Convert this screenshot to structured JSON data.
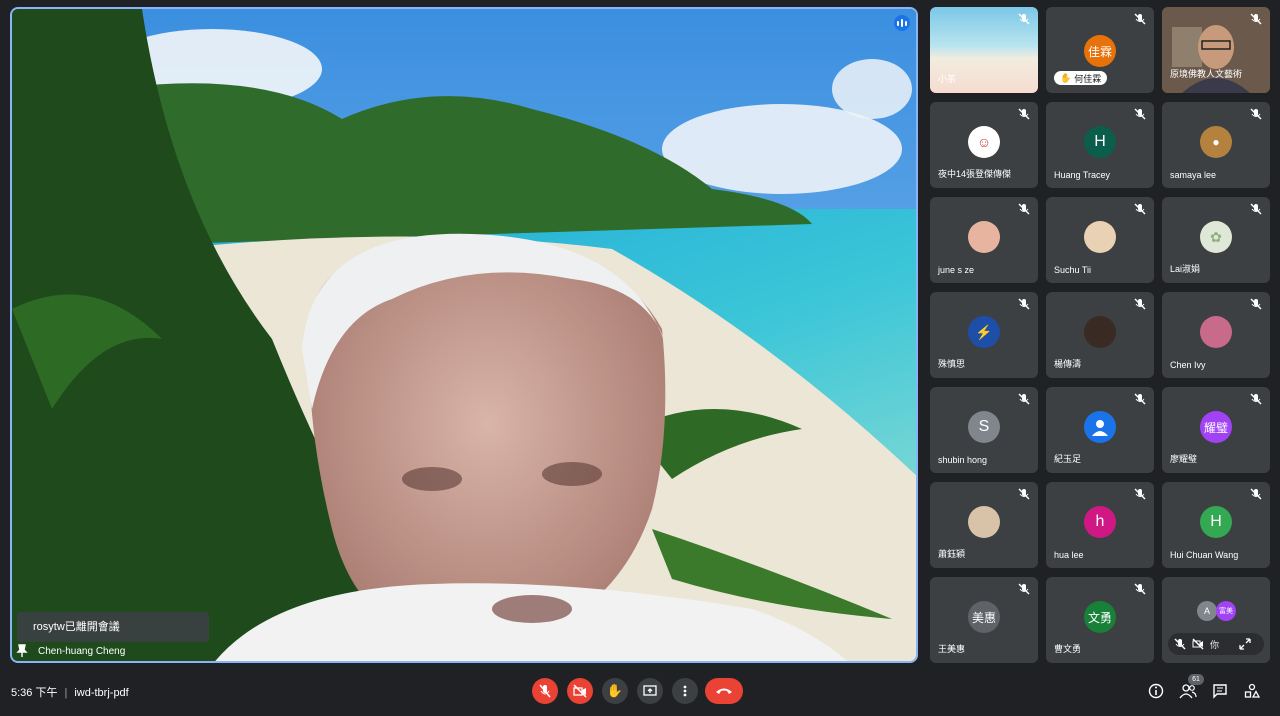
{
  "main_speaker": {
    "name": "Chen-huang Cheng",
    "toast": "rosytw已離開會議"
  },
  "participants": [
    {
      "name": "小茶",
      "type": "video"
    },
    {
      "name": "何佳霖",
      "type": "avatar",
      "initial": "佳霖",
      "color": "#e8710a",
      "hand_raised": true
    },
    {
      "name": "原境佛教人文藝術",
      "type": "video"
    },
    {
      "name": "夜中14張登傑傳傑",
      "type": "photo"
    },
    {
      "name": "Huang Tracey",
      "type": "avatar",
      "initial": "H",
      "color": "#0b5e4b"
    },
    {
      "name": "samaya lee",
      "type": "photo"
    },
    {
      "name": "june s ze",
      "type": "photo"
    },
    {
      "name": "Suchu Tii",
      "type": "photo"
    },
    {
      "name": "Lai淑娟",
      "type": "photo"
    },
    {
      "name": "殊慎思",
      "type": "photo"
    },
    {
      "name": "楊傳濤",
      "type": "photo"
    },
    {
      "name": "Chen Ivy",
      "type": "photo"
    },
    {
      "name": "shubin hong",
      "type": "avatar",
      "initial": "S",
      "color": "#80868b"
    },
    {
      "name": "紀玉足",
      "type": "photo"
    },
    {
      "name": "廖耀璧",
      "type": "avatar",
      "initial": "耀璧",
      "color": "#a142f4"
    },
    {
      "name": "蕭鈺穎",
      "type": "photo"
    },
    {
      "name": "hua lee",
      "type": "avatar",
      "initial": "h",
      "color": "#d01884"
    },
    {
      "name": "Hui Chuan Wang",
      "type": "avatar",
      "initial": "H",
      "color": "#34a853"
    },
    {
      "name": "王美惠",
      "type": "avatar",
      "initial": "美惠",
      "color": "#5f6368"
    },
    {
      "name": "曹文勇",
      "type": "avatar",
      "initial": "文勇",
      "color": "#188038"
    }
  ],
  "self_tile": {
    "mini_avatars": [
      {
        "initial": "A",
        "color": "#80868b"
      },
      {
        "initial": "富美",
        "color": "#a142f4"
      }
    ],
    "you_label": "你"
  },
  "bottom_bar": {
    "time": "5:36 下午",
    "meeting_code": "iwd-tbrj-pdf",
    "participant_count": "61"
  },
  "colors": {
    "accent": "#8ab4f8",
    "danger": "#ea4335",
    "tile_bg": "#3c4043",
    "page_bg": "#202124"
  }
}
